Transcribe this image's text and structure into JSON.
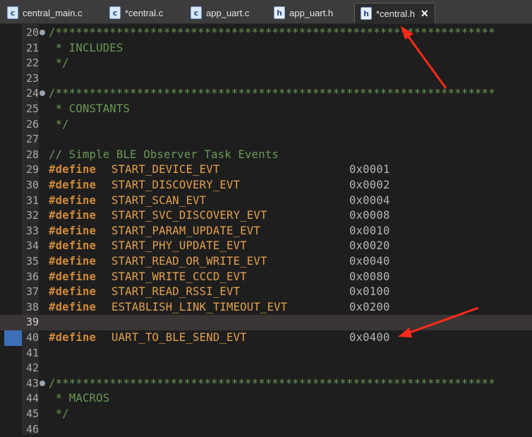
{
  "tabs": [
    {
      "name": "central_main.c",
      "icon": "c"
    },
    {
      "name": "*central.c",
      "icon": "c"
    },
    {
      "name": "app_uart.c",
      "icon": "c"
    },
    {
      "name": "app_uart.h",
      "icon": "h"
    },
    {
      "name": "*central.h",
      "icon": "h",
      "active": true,
      "close": "✕"
    }
  ],
  "code": {
    "ln20": "20",
    "line20": "/*****************************************************************",
    "ln21": "21",
    "line21": " * INCLUDES",
    "ln22": "22",
    "line22": " */",
    "ln23": "23",
    "ln24": "24",
    "line24": "/*****************************************************************",
    "ln25": "25",
    "line25": " * CONSTANTS",
    "ln26": "26",
    "line26": " */",
    "ln27": "27",
    "ln28": "28",
    "line28": "// Simple BLE Observer Task Events",
    "define_kw": "#define",
    "ln29": "29",
    "m29": "START_DEVICE_EVT",
    "v29": "0x0001",
    "ln30": "30",
    "m30": "START_DISCOVERY_EVT",
    "v30": "0x0002",
    "ln31": "31",
    "m31": "START_SCAN_EVT",
    "v31": "0x0004",
    "ln32": "32",
    "m32": "START_SVC_DISCOVERY_EVT",
    "v32": "0x0008",
    "ln33": "33",
    "m33": "START_PARAM_UPDATE_EVT",
    "v33": "0x0010",
    "ln34": "34",
    "m34": "START_PHY_UPDATE_EVT",
    "v34": "0x0020",
    "ln35": "35",
    "m35": "START_READ_OR_WRITE_EVT",
    "v35": "0x0040",
    "ln36": "36",
    "m36": "START_WRITE_CCCD_EVT",
    "v36": "0x0080",
    "ln37": "37",
    "m37": "START_READ_RSSI_EVT",
    "v37": "0x0100",
    "ln38": "38",
    "m38": "ESTABLISH_LINK_TIMEOUT_EVT",
    "v38": "0x0200",
    "ln39": "39",
    "ln40": "40",
    "m40": "UART_TO_BLE_SEND_EVT",
    "v40": "0x0400",
    "ln41": "41",
    "ln42": "42",
    "ln43": "43",
    "line43": "/*****************************************************************",
    "ln44": "44",
    "line44": " * MACROS",
    "ln45": "45",
    "line45": " */",
    "ln46": "46"
  },
  "colors": {
    "accent_arrow": "#ff2a1a",
    "selection": "#3d6fb8"
  }
}
